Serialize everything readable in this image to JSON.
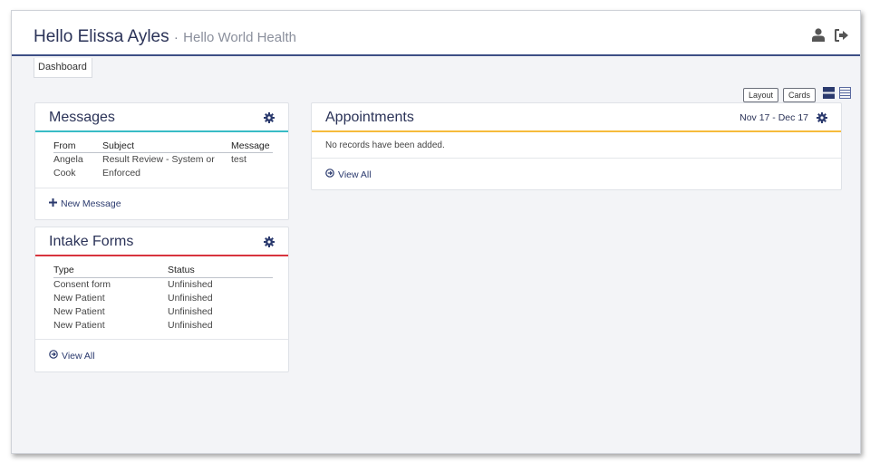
{
  "header": {
    "user_greeting": "Hello Elissa Ayles",
    "separator": "·",
    "org_name": "Hello World Health",
    "icons": [
      "user-icon",
      "sign-out-icon"
    ]
  },
  "breadcrumb": {
    "label": "Dashboard"
  },
  "toolbar": {
    "layout_label": "Layout",
    "cards_label": "Cards",
    "icons": [
      "list-view-icon",
      "compact-view-icon"
    ]
  },
  "messages": {
    "title": "Messages",
    "columns": [
      "From",
      "Subject",
      "Message"
    ],
    "rows": [
      {
        "from": "Angela Cook",
        "subject": "Result Review - System or Enforced",
        "message": "test"
      }
    ],
    "new_message_label": "New Message"
  },
  "intake_forms": {
    "title": "Intake Forms",
    "columns": [
      "Type",
      "Status"
    ],
    "rows": [
      {
        "type": "Consent form",
        "status": "Unfinished"
      },
      {
        "type": "New Patient",
        "status": "Unfinished"
      },
      {
        "type": "New Patient",
        "status": "Unfinished"
      },
      {
        "type": "New Patient",
        "status": "Unfinished"
      }
    ],
    "view_all_label": "View All"
  },
  "appointments": {
    "title": "Appointments",
    "date_range": "Nov 17 - Dec 17",
    "empty_text": "No records have been added.",
    "view_all_label": "View All"
  },
  "colors": {
    "navy": "#2b3358",
    "teal_accent": "#38bcc6",
    "red_accent": "#d8343e",
    "yellow_accent": "#f6bb3c",
    "header_rule": "#3d4f86"
  }
}
